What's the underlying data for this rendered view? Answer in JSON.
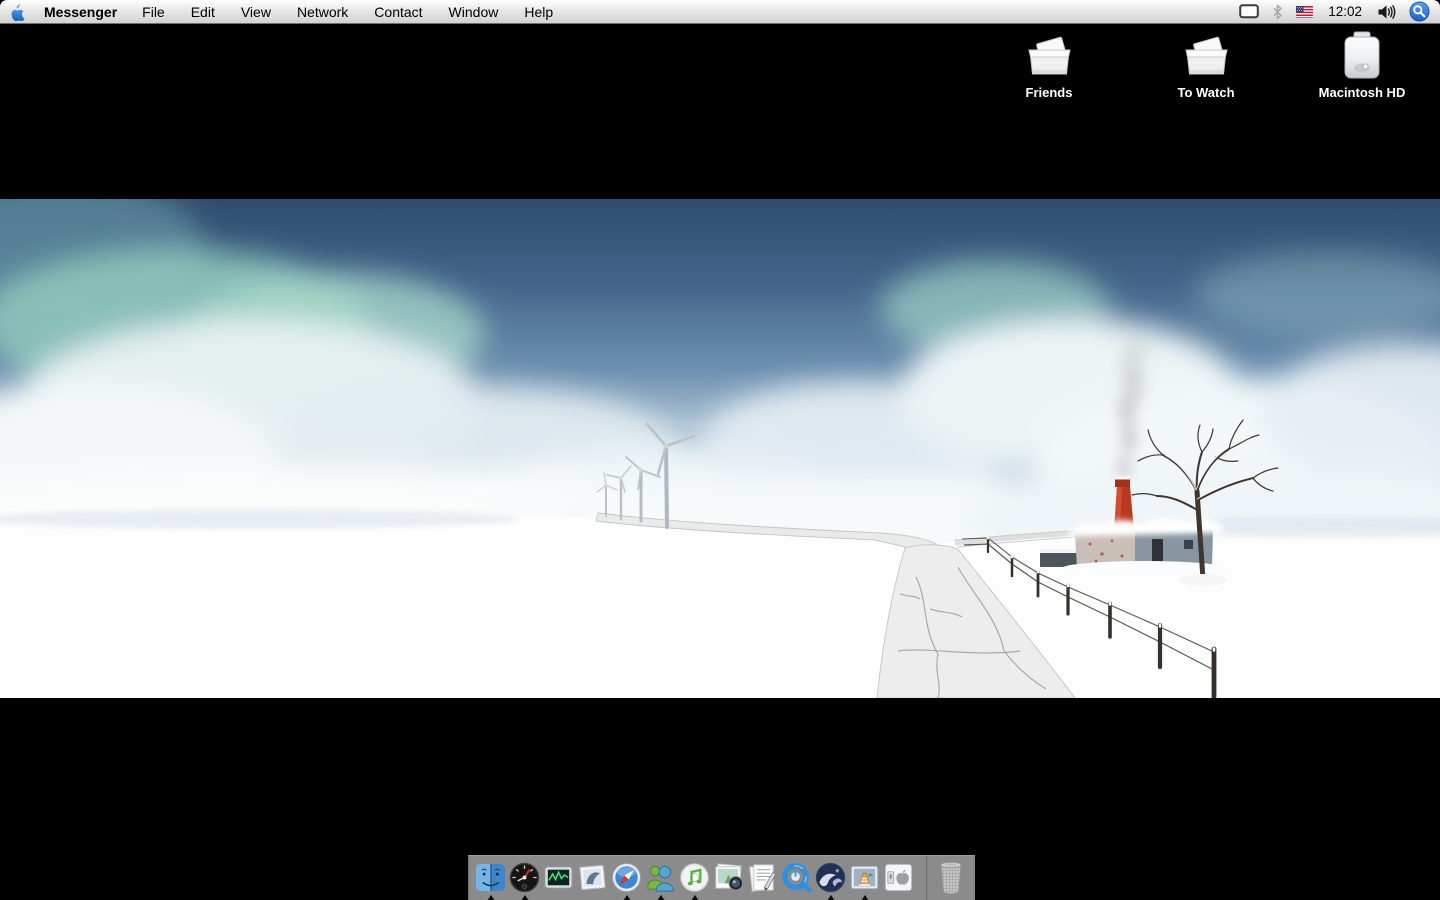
{
  "menubar": {
    "app_name": "Messenger",
    "menus": [
      "File",
      "Edit",
      "View",
      "Network",
      "Contact",
      "Window",
      "Help"
    ],
    "clock": "12:02",
    "keyboard_layout": "US",
    "status_icons": [
      "display-icon",
      "bluetooth-icon",
      "us-flag-icon",
      "volume-icon",
      "spotlight-icon"
    ]
  },
  "desktop_icons": [
    {
      "label": "Friends",
      "kind": "folder"
    },
    {
      "label": "To Watch",
      "kind": "folder"
    },
    {
      "label": "Macintosh HD",
      "kind": "hard-drive"
    }
  ],
  "dock": {
    "items": [
      {
        "name": "finder",
        "running": true
      },
      {
        "name": "dashboard",
        "running": true
      },
      {
        "name": "activity-monitor",
        "running": false
      },
      {
        "name": "mail",
        "running": false
      },
      {
        "name": "safari",
        "running": true
      },
      {
        "name": "msn-messenger",
        "running": true
      },
      {
        "name": "itunes",
        "running": true
      },
      {
        "name": "iphoto",
        "running": false
      },
      {
        "name": "textedit",
        "running": false
      },
      {
        "name": "quicktime-player",
        "running": false
      },
      {
        "name": "shiira-browser",
        "running": true
      },
      {
        "name": "vlc",
        "running": true
      },
      {
        "name": "system-preferences",
        "running": false
      }
    ]
  },
  "wallpaper": {
    "description": "Letterboxed winter wallpaper: snowy field with wind turbines, a cottage with smoking red chimney, bare tree, wire fence and cracked road under a cloudy blue sky",
    "colors": {
      "sky_top": "#31506f",
      "sky_horizon": "#c8d7e3",
      "snow": "#fefefe",
      "chimney_red": "#b93a22",
      "letterbox": "#000000"
    }
  }
}
